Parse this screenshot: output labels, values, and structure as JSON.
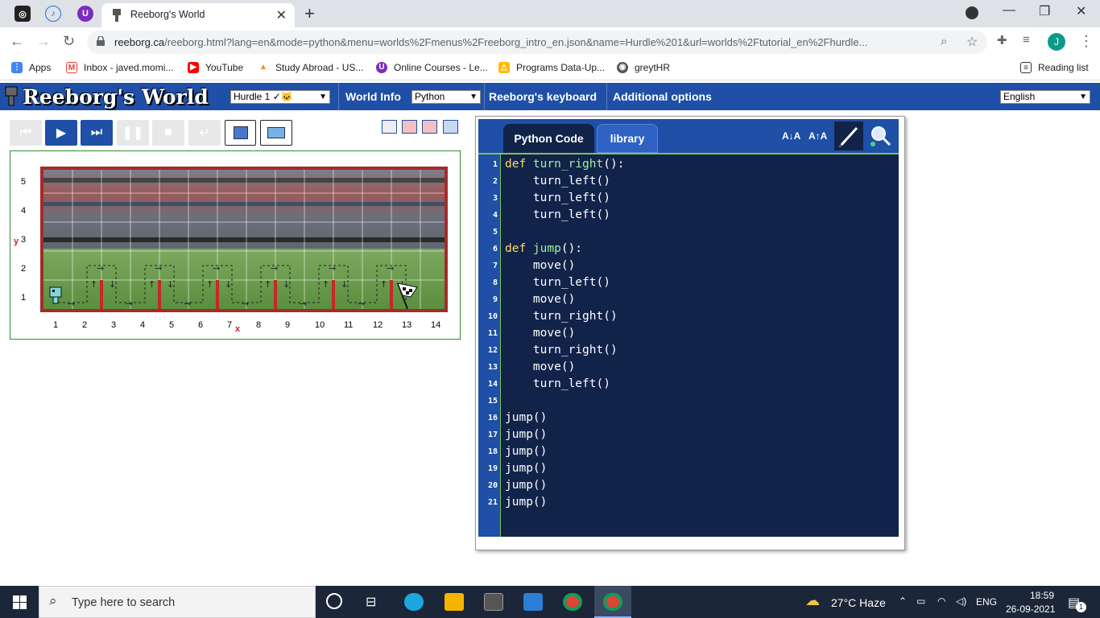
{
  "browser": {
    "tab_title": "Reeborg's World",
    "url_main": "reeborg.ca",
    "url_rest": "/reeborg.html?lang=en&mode=python&menu=worlds%2Fmenus%2Freeborg_intro_en.json&name=Hurdle%201&url=worlds%2Ftutorial_en%2Fhurdle...",
    "profile_initial": "J"
  },
  "bookmarks": [
    {
      "label": "Apps"
    },
    {
      "label": "Inbox - javed.momi..."
    },
    {
      "label": "YouTube"
    },
    {
      "label": "Study Abroad - US..."
    },
    {
      "label": "Online Courses - Le..."
    },
    {
      "label": "Programs Data-Up..."
    },
    {
      "label": "greytHR"
    }
  ],
  "reading_list": "Reading list",
  "app": {
    "logo": "Reeborg's World",
    "world_select": "Hurdle 1 ✓🐱",
    "world_info": "World Info",
    "mode_select": "Python",
    "keyboard": "Reeborg's keyboard",
    "options": "Additional options",
    "language": "English"
  },
  "world": {
    "y_axis_label": "y",
    "x_axis_label": "x",
    "y_ticks": [
      "5",
      "4",
      "3",
      "2",
      "1"
    ],
    "x_ticks": [
      "1",
      "2",
      "3",
      "4",
      "5",
      "6",
      "7",
      "8",
      "9",
      "10",
      "11",
      "12",
      "13",
      "14"
    ]
  },
  "editor": {
    "tab_code": "Python Code",
    "tab_library": "library",
    "font_down": "A↓A",
    "font_up": "A↑A",
    "lines": [
      {
        "n": "1",
        "t": "def turn_right():"
      },
      {
        "n": "2",
        "t": "    turn_left()"
      },
      {
        "n": "3",
        "t": "    turn_left()"
      },
      {
        "n": "4",
        "t": "    turn_left()"
      },
      {
        "n": "5",
        "t": ""
      },
      {
        "n": "6",
        "t": "def jump():"
      },
      {
        "n": "7",
        "t": "    move()"
      },
      {
        "n": "8",
        "t": "    turn_left()"
      },
      {
        "n": "9",
        "t": "    move()"
      },
      {
        "n": "10",
        "t": "    turn_right()"
      },
      {
        "n": "11",
        "t": "    move()"
      },
      {
        "n": "12",
        "t": "    turn_right()"
      },
      {
        "n": "13",
        "t": "    move()"
      },
      {
        "n": "14",
        "t": "    turn_left()"
      },
      {
        "n": "15",
        "t": ""
      },
      {
        "n": "16",
        "t": "jump()"
      },
      {
        "n": "17",
        "t": "jump()"
      },
      {
        "n": "18",
        "t": "jump()"
      },
      {
        "n": "19",
        "t": "jump()"
      },
      {
        "n": "20",
        "t": "jump()"
      },
      {
        "n": "21",
        "t": "jump()"
      }
    ]
  },
  "taskbar": {
    "search_placeholder": "Type here to search",
    "weather": "27°C  Haze",
    "lang": "ENG",
    "time": "18:59",
    "date": "26-09-2021",
    "notif_count": "1"
  }
}
